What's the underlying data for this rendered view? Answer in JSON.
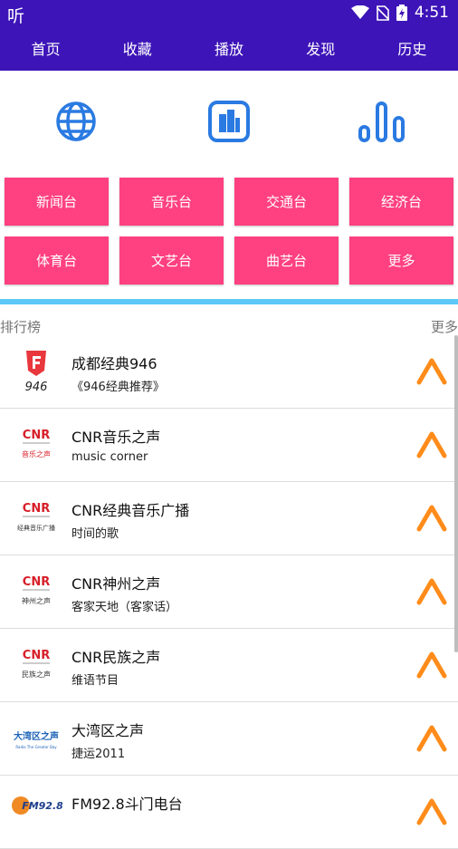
{
  "status": {
    "app_glyph": "听",
    "time": "4:51"
  },
  "nav": [
    "首页",
    "收藏",
    "播放",
    "发现",
    "历史"
  ],
  "categories": [
    "新闻台",
    "音乐台",
    "交通台",
    "经济台",
    "体育台",
    "文艺台",
    "曲艺台",
    "更多"
  ],
  "section": {
    "label": "排行榜",
    "more": "更多"
  },
  "items": [
    {
      "title": "成都经典946",
      "subtitle": "《946经典推荐》",
      "logo_text": "946"
    },
    {
      "title": "CNR音乐之声",
      "subtitle": "music corner",
      "logo_text": "CNR",
      "logo_sub": "音乐之声"
    },
    {
      "title": "CNR经典音乐广播",
      "subtitle": "时间的歌",
      "logo_text": "CNR",
      "logo_sub": "经典音乐广播"
    },
    {
      "title": "CNR神州之声",
      "subtitle": "客家天地（客家话）",
      "logo_text": "CNR",
      "logo_sub": "神州之声"
    },
    {
      "title": "CNR民族之声",
      "subtitle": "维语节目",
      "logo_text": "CNR",
      "logo_sub": "民族之声"
    },
    {
      "title": "大湾区之声",
      "subtitle": "捷运2011",
      "logo_text": "大湾区之声",
      "logo_sub": "Radio The Greater Bay"
    },
    {
      "title": "FM92.8斗门电台",
      "subtitle": "",
      "logo_text": "FM92.8"
    }
  ],
  "colors": {
    "primary": "#3D14B8",
    "accent": "#FF4081",
    "divider": "#5BC8F5",
    "icon_blue": "#2A7AE2",
    "up_orange": "#FF8C1A"
  }
}
